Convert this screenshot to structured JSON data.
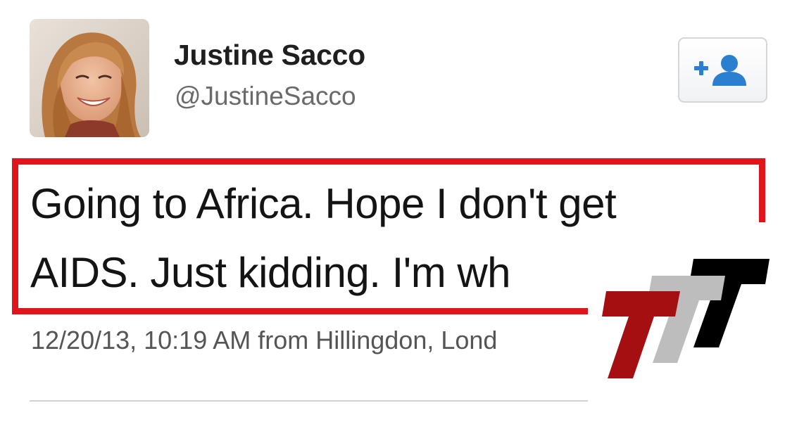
{
  "user": {
    "display_name": "Justine Sacco",
    "handle": "@JustineSacco",
    "avatar_icon": "user-profile-photo"
  },
  "follow_button": {
    "icon": "add-person-icon",
    "color": "#2a7fd0"
  },
  "tweet": {
    "line_1": "Going to Africa. Hope I don't get",
    "line_2": "AIDS. Just kidding. I'm wh",
    "highlight_color": "#e0141b"
  },
  "meta": {
    "timestamp": "12/20/13, 10:19 AM from Hillingdon, Lond"
  },
  "watermark": {
    "logo": "TTT",
    "colors": [
      "#a50f12",
      "#bdbdbd",
      "#000000"
    ]
  }
}
